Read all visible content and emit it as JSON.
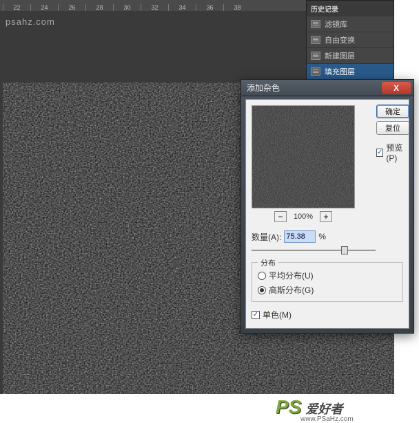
{
  "ruler_marks": [
    "22",
    "24",
    "26",
    "28",
    "30",
    "32",
    "34",
    "36",
    "38"
  ],
  "history": {
    "title": "历史记录",
    "items": [
      "滤镜库",
      "自由变换",
      "新建图层",
      "填充图层"
    ]
  },
  "dialog": {
    "title": "添加杂色",
    "ok": "确定",
    "cancel": "复位",
    "preview_label": "预览(P)",
    "preview_checked": true,
    "zoom": "100%",
    "zoom_minus": "−",
    "zoom_plus": "+",
    "amount_label": "数量(A):",
    "amount_value": "75.38",
    "amount_unit": "%",
    "dist_label": "分布",
    "uniform": "平均分布(U)",
    "gaussian": "高斯分布(G)",
    "dist_selected": "gaussian",
    "mono": "单色(M)",
    "mono_checked": true,
    "close_glyph": "X"
  },
  "watermark": {
    "corner": "psahz.com",
    "footer_big": "PS",
    "footer_cn": "爱好者",
    "footer_url": "www.PSaHz.com"
  }
}
